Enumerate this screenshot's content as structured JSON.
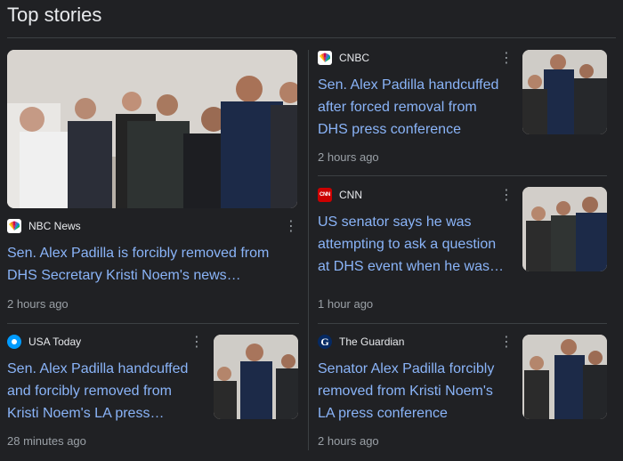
{
  "section": {
    "title": "Top stories"
  },
  "colors": {
    "background": "#202124",
    "headline": "#8ab4f8",
    "divider": "#3c4043",
    "cnn_red": "#cc0000",
    "guardian_blue": "#052962",
    "usa_today_blue": "#009bff"
  },
  "stories": [
    {
      "source": "NBC News",
      "logo_icon": "nbc-peacock-icon",
      "headline": "Sen. Alex Padilla is forcibly removed from DHS Secretary Kristi Noem's news…",
      "time": "2 hours ago"
    },
    {
      "source": "CNBC",
      "logo_icon": "cnbc-peacock-icon",
      "headline": "Sen. Alex Padilla handcuffed after forced removal from DHS press conference",
      "time": "2 hours ago"
    },
    {
      "source": "CNN",
      "logo_icon": "cnn-logo-icon",
      "logo_text": "CNN",
      "headline": "US senator says he was attempting to ask a question at DHS event when he was…",
      "time": "1 hour ago"
    },
    {
      "source": "USA Today",
      "logo_icon": "usa-today-logo-icon",
      "headline": "Sen. Alex Padilla handcuffed and forcibly removed from Kristi Noem's LA press…",
      "time": "28 minutes ago"
    },
    {
      "source": "The Guardian",
      "logo_icon": "guardian-logo-icon",
      "logo_text": "G",
      "headline": "Senator Alex Padilla forcibly removed from Kristi Noem's LA press conference",
      "time": "2 hours ago"
    }
  ],
  "menu": {
    "more_icon": "more-vert-icon",
    "more_glyph": "⋮"
  }
}
